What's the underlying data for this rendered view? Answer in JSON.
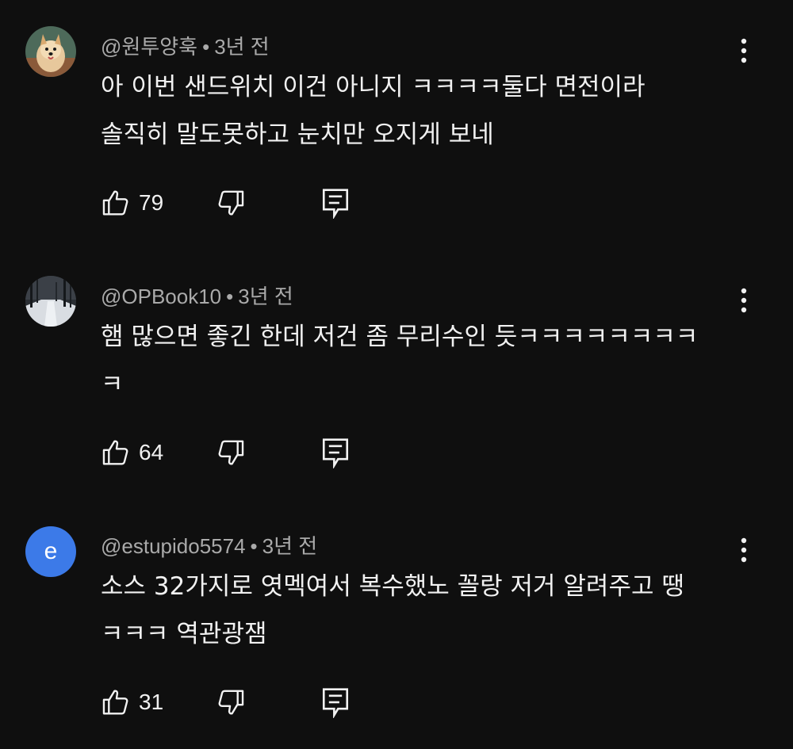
{
  "comments": [
    {
      "handle": "@원투양훅",
      "separator": "•",
      "time": "3년 전",
      "lines": [
        "아 이번 샌드위치 이건 아니지 ㅋㅋㅋㅋ둘다 면전이라",
        "솔직히 말도못하고 눈치만 오지게 보네"
      ],
      "like_count": "79",
      "avatar_type": "dog-photo"
    },
    {
      "handle": "@OPBook10",
      "separator": "•",
      "time": "3년 전",
      "lines": [
        "햄 많으면 좋긴 한데 저건 좀 무리수인 듯ㅋㅋㅋㅋㅋㅋㅋㅋ",
        "ㅋ"
      ],
      "like_count": "64",
      "avatar_type": "snowy-forest-photo"
    },
    {
      "handle": "@estupido5574",
      "separator": "•",
      "time": "3년 전",
      "lines": [
        "소스 32가지로 엿멕여서 복수했노 꼴랑 저거 알려주고 땡",
        "ㅋㅋㅋ 역관광잼"
      ],
      "like_count": "31",
      "avatar_type": "letter",
      "avatar_letter": "e",
      "avatar_color": "#3c7ae8"
    }
  ],
  "icons": {
    "like": "thumbs-up-icon",
    "dislike": "thumbs-down-icon",
    "reply": "reply-icon",
    "more": "more-vert-icon"
  },
  "colors": {
    "background": "#0f0f0f",
    "text": "#f1f1f1",
    "secondary_text": "#aaaaaa"
  }
}
